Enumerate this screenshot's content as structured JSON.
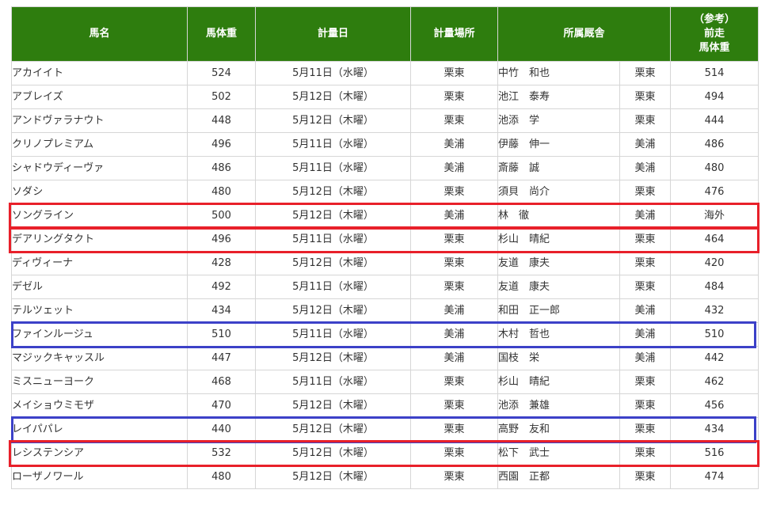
{
  "header": {
    "name": "馬名",
    "weight": "馬体重",
    "date": "計量日",
    "place": "計量場所",
    "stable": "所属厩舎",
    "prev_line1": "（参考）",
    "prev_line2": "前走",
    "prev_line3": "馬体重"
  },
  "rows": [
    {
      "name": "アカイイト",
      "weight": "524",
      "date": "5月11日（水曜）",
      "place": "栗東",
      "trainer": "中竹　和也",
      "affil": "栗東",
      "prev": "514"
    },
    {
      "name": "アブレイズ",
      "weight": "502",
      "date": "5月12日（木曜）",
      "place": "栗東",
      "trainer": "池江　泰寿",
      "affil": "栗東",
      "prev": "494"
    },
    {
      "name": "アンドヴァラナウト",
      "weight": "448",
      "date": "5月12日（木曜）",
      "place": "栗東",
      "trainer": "池添　学",
      "affil": "栗東",
      "prev": "444"
    },
    {
      "name": "クリノプレミアム",
      "weight": "496",
      "date": "5月11日（水曜）",
      "place": "美浦",
      "trainer": "伊藤　伸一",
      "affil": "美浦",
      "prev": "486"
    },
    {
      "name": "シャドウディーヴァ",
      "weight": "486",
      "date": "5月11日（水曜）",
      "place": "美浦",
      "trainer": "斎藤　誠",
      "affil": "美浦",
      "prev": "480"
    },
    {
      "name": "ソダシ",
      "weight": "480",
      "date": "5月12日（木曜）",
      "place": "栗東",
      "trainer": "須貝　尚介",
      "affil": "栗東",
      "prev": "476"
    },
    {
      "name": "ソングライン",
      "weight": "500",
      "date": "5月12日（木曜）",
      "place": "美浦",
      "trainer": "林　徹",
      "affil": "美浦",
      "prev": "海外"
    },
    {
      "name": "デアリングタクト",
      "weight": "496",
      "date": "5月11日（水曜）",
      "place": "栗東",
      "trainer": "杉山　晴紀",
      "affil": "栗東",
      "prev": "464"
    },
    {
      "name": "ディヴィーナ",
      "weight": "428",
      "date": "5月12日（木曜）",
      "place": "栗東",
      "trainer": "友道　康夫",
      "affil": "栗東",
      "prev": "420"
    },
    {
      "name": "デゼル",
      "weight": "492",
      "date": "5月11日（水曜）",
      "place": "栗東",
      "trainer": "友道　康夫",
      "affil": "栗東",
      "prev": "484"
    },
    {
      "name": "テルツェット",
      "weight": "434",
      "date": "5月12日（木曜）",
      "place": "美浦",
      "trainer": "和田　正一郎",
      "affil": "美浦",
      "prev": "432"
    },
    {
      "name": "ファインルージュ",
      "weight": "510",
      "date": "5月11日（水曜）",
      "place": "美浦",
      "trainer": "木村　哲也",
      "affil": "美浦",
      "prev": "510"
    },
    {
      "name": "マジックキャッスル",
      "weight": "447",
      "date": "5月12日（木曜）",
      "place": "美浦",
      "trainer": "国枝　栄",
      "affil": "美浦",
      "prev": "442"
    },
    {
      "name": "ミスニューヨーク",
      "weight": "468",
      "date": "5月11日（水曜）",
      "place": "栗東",
      "trainer": "杉山　晴紀",
      "affil": "栗東",
      "prev": "462"
    },
    {
      "name": "メイショウミモザ",
      "weight": "470",
      "date": "5月12日（木曜）",
      "place": "栗東",
      "trainer": "池添　兼雄",
      "affil": "栗東",
      "prev": "456"
    },
    {
      "name": "レイパパレ",
      "weight": "440",
      "date": "5月12日（木曜）",
      "place": "栗東",
      "trainer": "高野　友和",
      "affil": "栗東",
      "prev": "434"
    },
    {
      "name": "レシステンシア",
      "weight": "532",
      "date": "5月12日（木曜）",
      "place": "栗東",
      "trainer": "松下　武士",
      "affil": "栗東",
      "prev": "516"
    },
    {
      "name": "ローザノワール",
      "weight": "480",
      "date": "5月12日（木曜）",
      "place": "栗東",
      "trainer": "西園　正都",
      "affil": "栗東",
      "prev": "474"
    }
  ],
  "highlights": [
    {
      "row": 6,
      "color": "#e8202a"
    },
    {
      "row": 7,
      "color": "#e8202a"
    },
    {
      "row": 11,
      "color": "#3c41c8"
    },
    {
      "row": 15,
      "color": "#3c41c8"
    },
    {
      "row": 16,
      "color": "#e8202a"
    }
  ]
}
